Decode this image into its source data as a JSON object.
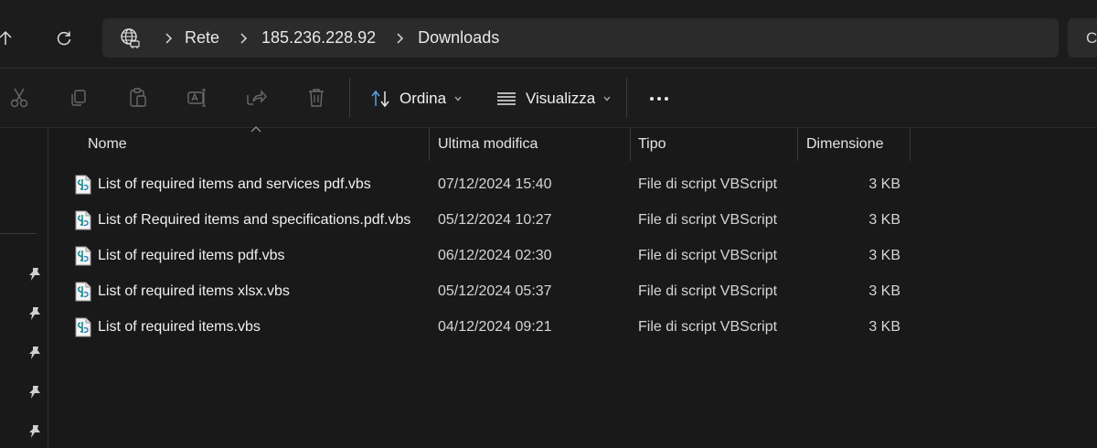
{
  "address": {
    "crumbs": [
      "Rete",
      "185.236.228.92",
      "Downloads"
    ],
    "search_label": "C"
  },
  "toolbar": {
    "sort_label": "Ordina",
    "view_label": "Visualizza"
  },
  "columns": {
    "name": "Nome",
    "modified": "Ultima modifica",
    "type": "Tipo",
    "size": "Dimensione"
  },
  "files": [
    {
      "name": "List of required items and services pdf.vbs",
      "modified": "07/12/2024 15:40",
      "type": "File di script VBScript",
      "size": "3 KB"
    },
    {
      "name": "List of Required items and specifications.pdf.vbs",
      "modified": "05/12/2024 10:27",
      "type": "File di script VBScript",
      "size": "3 KB"
    },
    {
      "name": "List of required items pdf.vbs",
      "modified": "06/12/2024 02:30",
      "type": "File di script VBScript",
      "size": "3 KB"
    },
    {
      "name": "List of required items xlsx.vbs",
      "modified": "05/12/2024 05:37",
      "type": "File di script VBScript",
      "size": "3 KB"
    },
    {
      "name": "List of required items.vbs",
      "modified": "04/12/2024 09:21",
      "type": "File di script VBScript",
      "size": "3 KB"
    }
  ],
  "icons": {
    "up": "arrow-up-icon",
    "refresh": "refresh-icon",
    "network": "network-globe-icon",
    "cut": "cut-icon",
    "copy": "copy-icon",
    "paste": "paste-icon",
    "rename": "rename-icon",
    "share": "share-icon",
    "delete": "trash-icon",
    "sort": "sort-icon",
    "view": "view-list-icon",
    "more": "more-icon",
    "pin": "pin-icon",
    "file": "vbscript-file-icon"
  }
}
